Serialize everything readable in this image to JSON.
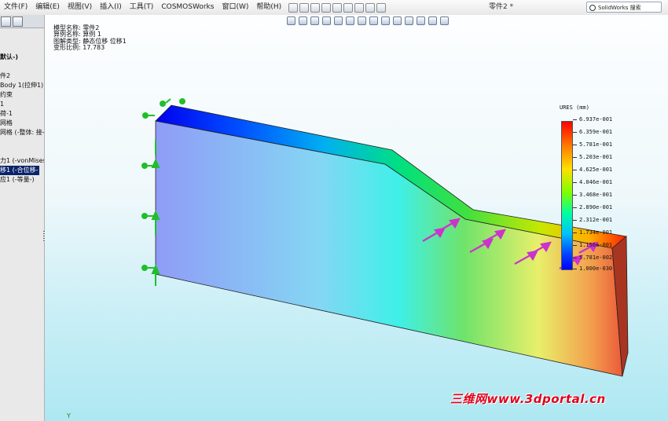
{
  "menubar": {
    "items": [
      "文件(F)",
      "编辑(E)",
      "视图(V)",
      "插入(I)",
      "工具(T)",
      "COSMOSWorks",
      "窗口(W)",
      "帮助(H)"
    ],
    "document_title": "零件2 *",
    "search_label": "SolidWorks 搜索"
  },
  "sidebar": {
    "tree": [
      "默认-)",
      "",
      "件2",
      "Body 1(拉伸1)",
      "约束",
      "1",
      "荷-1",
      "网格",
      "网格 (-整体: 接-",
      "",
      "",
      "力1 (-vonMises-",
      "移1 (-合位移-",
      "应1 (-等量-)"
    ]
  },
  "study_info": {
    "rows": [
      "模型名称: 零件2",
      "算例名称: 算例 1",
      "图解类型: 静态位移 位移1",
      "变形比例: 17.783"
    ]
  },
  "legend": {
    "title": "URES (mm)",
    "ticks": [
      "6.937e-001",
      "6.359e-001",
      "5.781e-001",
      "5.203e-001",
      "4.625e-001",
      "4.046e-001",
      "3.468e-001",
      "2.890e-001",
      "2.312e-001",
      "1.734e-001",
      "1.156e-001",
      "5.781e-002",
      "1.000e-030"
    ]
  },
  "watermark": "三维网www.3dportal.cn",
  "axis_label": "Y",
  "colors": {
    "background_top": "#fdfeff",
    "background_bottom": "#aee8f2",
    "fixture_green": "#1fbf2a",
    "load_magenta": "#cc33cc",
    "selection": "#0a246a"
  }
}
